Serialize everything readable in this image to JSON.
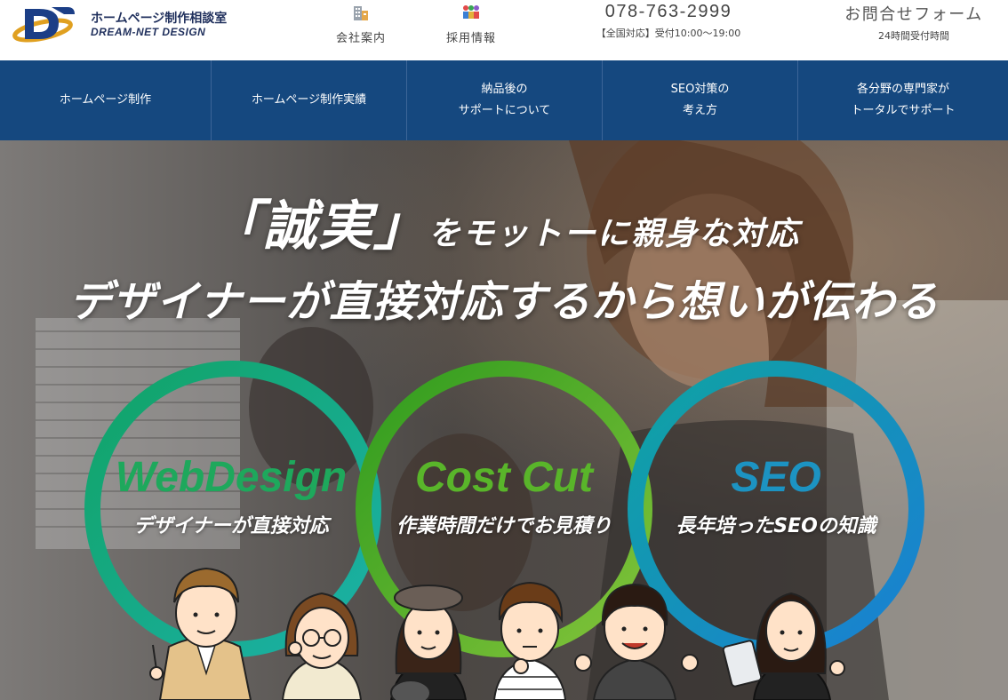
{
  "brand": {
    "title": "ホームページ制作相談室",
    "subtitle": "DREAM-NET DESIGN",
    "colors": {
      "navy": "#15487f",
      "logo_blue": "#1b3e86",
      "logo_gold": "#e0a020"
    }
  },
  "header_nav": [
    {
      "label": "会社案内",
      "icon": "building-icon"
    },
    {
      "label": "採用情報",
      "icon": "people-icon"
    }
  ],
  "phone": {
    "number": "078-763-2999",
    "hours": "【全国対応】受付10:00〜19:00"
  },
  "contact": {
    "title": "お問合せフォーム",
    "subtitle": "24時間受付時間"
  },
  "global_nav": [
    {
      "label": "ホームページ制作"
    },
    {
      "label": "ホームページ制作実績"
    },
    {
      "label": "納品後の\nサポートについて"
    },
    {
      "label": "SEO対策の\n考え方"
    },
    {
      "label": "各分野の専門家が\nトータルでサポート"
    }
  ],
  "hero": {
    "line1_emphasis": "「誠実」",
    "line1_rest": "をモットーに親身な対応",
    "line2": "デザイナーが直接対応するから想いが伝わる",
    "features": [
      {
        "title": "WebDesign",
        "subtitle": "デザイナーが直接対応",
        "color": "#1ea85c"
      },
      {
        "title": "Cost Cut",
        "subtitle": "作業時間だけでお見積り",
        "color": "#59b52a"
      },
      {
        "title": "SEO",
        "subtitle": "長年培ったSEOの知識",
        "color": "#1c93c2"
      }
    ]
  }
}
